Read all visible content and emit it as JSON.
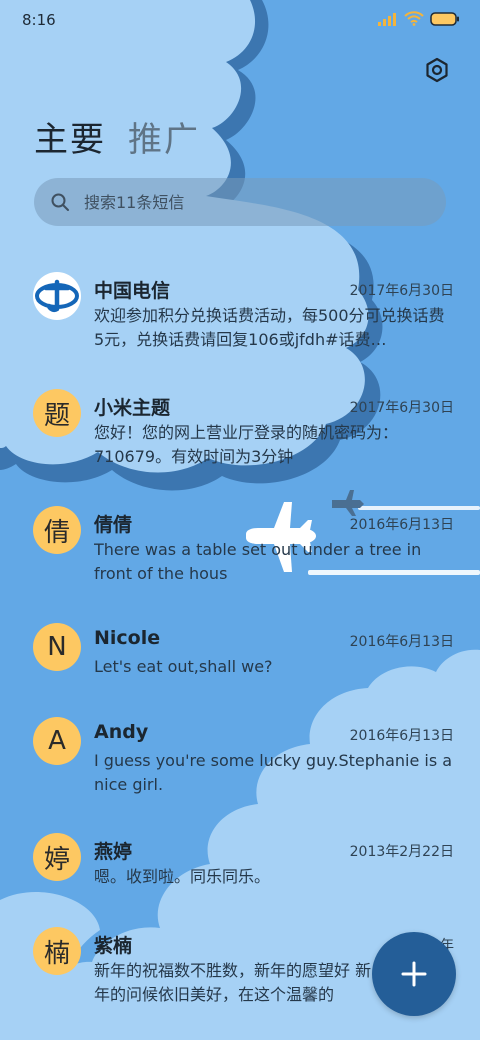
{
  "status_bar": {
    "time": "8:16"
  },
  "tabs": [
    {
      "label": "主要",
      "active": true
    },
    {
      "label": "推广",
      "active": false
    }
  ],
  "search": {
    "placeholder": "搜索11条短信"
  },
  "colors": {
    "background": "#62a8e6",
    "cloud": "#a6d1f5",
    "avatar": "#fdc862",
    "fab": "#245e98",
    "battery": "#fdc862"
  },
  "messages": [
    {
      "sender": "中国电信",
      "avatar": "china-telecom-logo",
      "date": "2017年6月30日",
      "preview": "欢迎参加积分兑换话费活动，每500分可兑换话费5元，兑换话费请回复106或jfdh#话费…"
    },
    {
      "sender": "小米主题",
      "avatar": "题",
      "date": "2017年6月30日",
      "preview": "您好！您的网上营业厅登录的随机密码为：710679。有效时间为3分钟"
    },
    {
      "sender": "倩倩",
      "avatar": "倩",
      "date": "2016年6月13日",
      "preview": "There was a table set out under a tree in front of the hous"
    },
    {
      "sender": "Nicole",
      "avatar": "N",
      "date": "2016年6月13日",
      "preview": "Let's eat out,shall we?"
    },
    {
      "sender": "Andy",
      "avatar": "A",
      "date": "2016年6月13日",
      "preview": "I guess you're some lucky guy.Stephanie is a nice girl."
    },
    {
      "sender": "燕婷",
      "avatar": "婷",
      "date": "2013年2月22日",
      "preview": "嗯。收到啦。同乐同乐。"
    },
    {
      "sender": "紫楠",
      "avatar": "楠",
      "date": "2013年",
      "preview": "新年的祝福数不胜数，新年的愿望好 新年的问候依旧美好，在这个温馨的"
    }
  ],
  "icons": {
    "settings": "gear-icon",
    "search": "search-icon",
    "compose": "plus-icon",
    "signal": "signal-icon",
    "wifi": "wifi-icon",
    "battery": "battery-icon"
  }
}
